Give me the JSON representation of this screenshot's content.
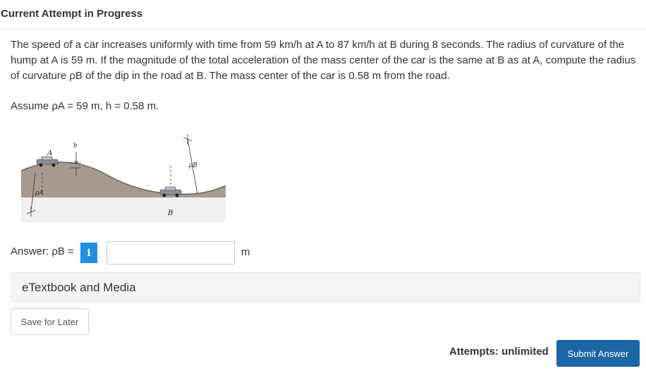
{
  "header": {
    "title": "Current Attempt in Progress"
  },
  "question": {
    "text": "The speed of a car increases uniformly with time from 59 km/h at A to 87 km/h at B during 8 seconds. The radius of curvature of the hump at A is 59 m. If the magnitude of the total acceleration of the mass center of the car is the same at B as at A, compute the radius of curvature ρB of the dip in the road at B. The mass center of the car is 0.58 m from the road.",
    "assume": "Assume ρA = 59 m, h = 0.58 m."
  },
  "figure": {
    "label_a": "A",
    "label_b": "B",
    "label_h": "h",
    "label_rho_a": "ρA",
    "label_rho_b": "ρB"
  },
  "answer": {
    "label": "Answer: ρB =",
    "info_icon": "i",
    "value": "",
    "placeholder": "",
    "unit": "m"
  },
  "etextbook": {
    "label": "eTextbook and Media"
  },
  "actions": {
    "save_label": "Save for Later",
    "attempts_text": "Attempts: unlimited",
    "submit_label": "Submit Answer"
  }
}
